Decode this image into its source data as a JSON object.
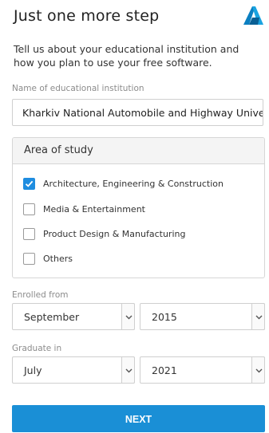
{
  "header": {
    "title": "Just one more step"
  },
  "intro": "Tell us about your educational institution and how you plan to use your free software.",
  "institution": {
    "label": "Name of educational institution",
    "value": "Kharkiv National Automobile and Highway University"
  },
  "study": {
    "title": "Area of study",
    "options": [
      {
        "label": "Architecture, Engineering & Construction",
        "checked": true
      },
      {
        "label": "Media & Entertainment",
        "checked": false
      },
      {
        "label": "Product Design & Manufacturing",
        "checked": false
      },
      {
        "label": "Others",
        "checked": false
      }
    ]
  },
  "enrolled": {
    "label": "Enrolled from",
    "month": "September",
    "year": "2015"
  },
  "graduate": {
    "label": "Graduate in",
    "month": "July",
    "year": "2021"
  },
  "next_label": "NEXT",
  "colors": {
    "accent": "#1a8fd6",
    "logo_dark": "#0a6fa8",
    "logo_light": "#2fb0e8"
  },
  "icons": {
    "logo": "autodesk-logo-icon",
    "check": "checkmark-icon",
    "caret": "chevron-down-icon"
  }
}
